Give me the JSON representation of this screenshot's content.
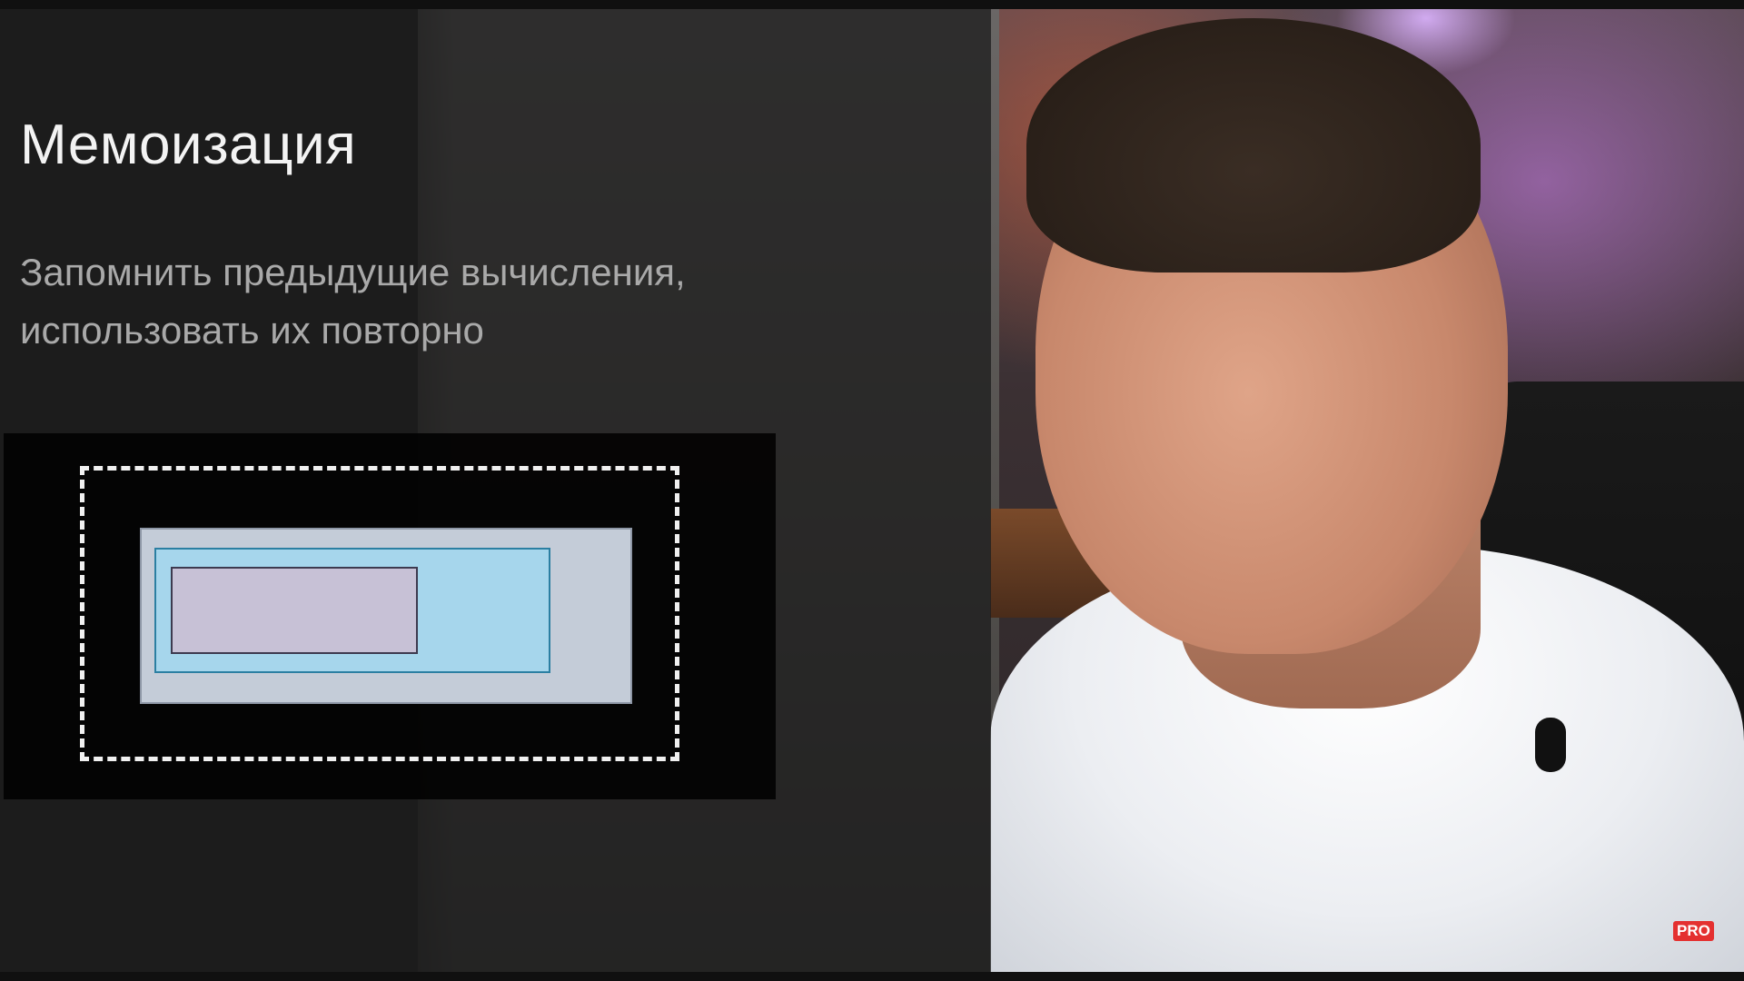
{
  "slide": {
    "title": "Мемоизация",
    "subtitle_line1": "Запомнить предыдущие вычисления,",
    "subtitle_line2": "использовать их повторно"
  },
  "badge": {
    "label": "PRO",
    "color": "#e43030"
  },
  "diagram": {
    "colors": {
      "dashed_border": "#f0f0f0",
      "outer": "#c4ccd8",
      "middle": "#a6d6ec",
      "inner": "#c7c1d6"
    }
  }
}
